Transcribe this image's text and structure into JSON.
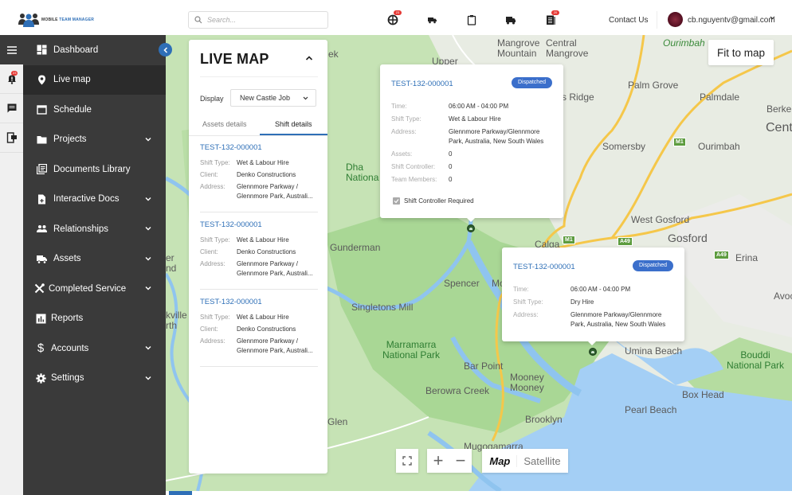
{
  "header": {
    "logo": {
      "part1": "MOBILE",
      "part2": "TEAM MANAGER"
    },
    "search_placeholder": "Search...",
    "icons": [
      {
        "name": "globe-icon",
        "badge": "23"
      },
      {
        "name": "truck-fast-icon",
        "badge": null
      },
      {
        "name": "clipboard-icon",
        "badge": null
      },
      {
        "name": "truck-icon",
        "badge": null
      },
      {
        "name": "document-list-icon",
        "badge": "20"
      }
    ],
    "contact_label": "Contact Us",
    "user_email": "cb.nguyentv@gmail.com"
  },
  "rail": {
    "notifications_badge": "23"
  },
  "sidebar": {
    "items": [
      {
        "label": "Dashboard",
        "icon": "dashboard-icon",
        "expandable": false,
        "active": false
      },
      {
        "label": "Live map",
        "icon": "map-pin-icon",
        "expandable": false,
        "active": true
      },
      {
        "label": "Schedule",
        "icon": "calendar-icon",
        "expandable": false,
        "active": false
      },
      {
        "label": "Projects",
        "icon": "folder-icon",
        "expandable": true,
        "active": false
      },
      {
        "label": "Documents Library",
        "icon": "library-icon",
        "expandable": false,
        "active": false
      },
      {
        "label": "Interactive Docs",
        "icon": "doc-add-icon",
        "expandable": true,
        "active": false
      },
      {
        "label": "Relationships",
        "icon": "people-icon",
        "expandable": true,
        "active": false
      },
      {
        "label": "Assets",
        "icon": "truck-icon",
        "expandable": true,
        "active": false
      },
      {
        "label": "Completed Service",
        "icon": "tools-icon",
        "expandable": true,
        "active": false
      },
      {
        "label": "Reports",
        "icon": "report-icon",
        "expandable": false,
        "active": false
      },
      {
        "label": "Accounts",
        "icon": "dollar-icon",
        "expandable": true,
        "active": false
      },
      {
        "label": "Settings",
        "icon": "gear-icon",
        "expandable": true,
        "active": false
      }
    ]
  },
  "panel": {
    "title": "LIVE MAP",
    "display_label": "Display",
    "display_value": "New Castle Job",
    "tabs": [
      {
        "label": "Assets details",
        "active": false
      },
      {
        "label": "Shift details",
        "active": true
      }
    ],
    "field_labels": {
      "shift_type": "Shift Type:",
      "client": "Client:",
      "address": "Address:"
    },
    "shifts": [
      {
        "id": "TEST-132-000001",
        "shift_type": "Wet & Labour Hire",
        "client": "Denko Constructions",
        "address_line1": "Glennmore Parkway /",
        "address_line2": "Glennmore Park, Australi..."
      },
      {
        "id": "TEST-132-000001",
        "shift_type": "Wet & Labour Hire",
        "client": "Denko Constructions",
        "address_line1": "Glennmore Parkway /",
        "address_line2": "Glennmore Park, Australi..."
      },
      {
        "id": "TEST-132-000001",
        "shift_type": "Wet & Labour Hire",
        "client": "Denko Constructions",
        "address_line1": "Glennmore Parkway /",
        "address_line2": "Glennmore Park, Australi..."
      }
    ]
  },
  "popups": [
    {
      "id": "TEST-132-000001",
      "status": "Dispatched",
      "time_label": "Time:",
      "time": "06:00 AM - 04:00 PM",
      "shift_type_label": "Shift Type:",
      "shift_type": "Wet & Labour Hire",
      "address_label": "Address:",
      "address_line1": "Glennmore Parkway/Glennmore",
      "address_line2": "Park, Australia, New South Wales",
      "assets_label": "Assets:",
      "assets": "0",
      "controller_label": "Shift Controller:",
      "controller": "0",
      "members_label": "Team Members:",
      "members": "0",
      "checkbox_label": "Shift Controller Required",
      "checkbox_checked": true
    },
    {
      "id": "TEST-132-000001",
      "status": "Dispatched",
      "time_label": "Time:",
      "time": "06:00 AM - 04:00 PM",
      "shift_type_label": "Shift Type:",
      "shift_type": "Dry Hire",
      "address_label": "Address:",
      "address_line1": "Glennmore Parkway/Glennmore",
      "address_line2": "Park, Australia, New South Wales"
    }
  ],
  "map": {
    "fit_label": "Fit to map",
    "zoom_in": "+",
    "zoom_out": "−",
    "type_map": "Map",
    "type_satellite": "Satellite",
    "places": {
      "mangrove_mountain": [
        "Mangrove",
        "Mountain"
      ],
      "central_mangrove": [
        "Central",
        "Mangrove"
      ],
      "ourimbah_top": "Ourimbah",
      "upper": "Upper",
      "palm_grove": "Palm Grove",
      "palmdale": "Palmdale",
      "ridge": "s Ridge",
      "berkeley": "Berkel",
      "central": "Cent",
      "somersby": "Somersby",
      "ourimbah": "Ourimbah",
      "dharug": [
        "Dha",
        "Nationa"
      ],
      "west_gosford": "West Gosford",
      "gosford": "Gosford",
      "calga": "Calga",
      "erina": "Erina",
      "gunderman": "Gunderman",
      "spencer": "Spencer",
      "mo": "Mo",
      "singletons_mill": "Singletons Mill",
      "avoca": "Avoca",
      "marramarra": [
        "Marramarra",
        "National Park"
      ],
      "bar_point": "Bar Point",
      "mooney": [
        "Mooney",
        "Mooney"
      ],
      "umina_beach": "Umina Beach",
      "bouddi": [
        "Bouddi",
        "National Park"
      ],
      "box_head": "Box Head",
      "berowra_creek": "Berowra Creek",
      "pearl_beach": "Pearl Beach",
      "brooklyn": "Brooklyn",
      "glen": "Glen",
      "mugamarra": "Mugogamarra",
      "ek": "ek",
      "er_nd": [
        "er",
        "nd"
      ],
      "kville": [
        "kville",
        "rth"
      ]
    },
    "road_shields": [
      "M1",
      "M1",
      "A49",
      "A49"
    ]
  }
}
